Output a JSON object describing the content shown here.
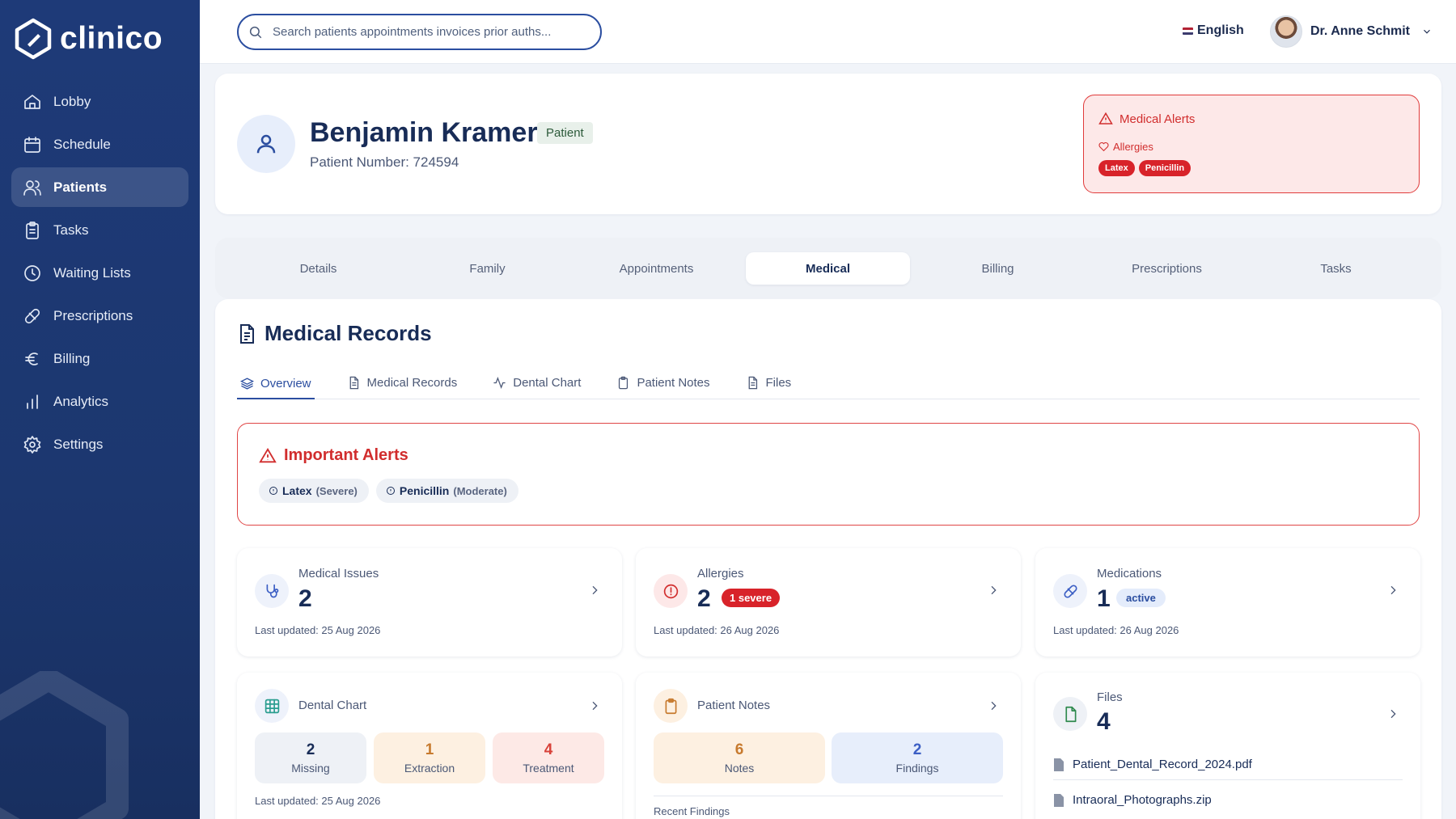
{
  "app": {
    "brand": "clinico"
  },
  "sidebar": {
    "items": [
      {
        "label": "Lobby",
        "icon": "home-icon"
      },
      {
        "label": "Schedule",
        "icon": "calendar-icon"
      },
      {
        "label": "Patients",
        "icon": "users-icon",
        "active": true
      },
      {
        "label": "Tasks",
        "icon": "clipboard-icon"
      },
      {
        "label": "Waiting Lists",
        "icon": "clock-icon"
      },
      {
        "label": "Prescriptions",
        "icon": "pill-icon"
      },
      {
        "label": "Billing",
        "icon": "euro-icon"
      },
      {
        "label": "Analytics",
        "icon": "bar-chart-icon"
      },
      {
        "label": "Settings",
        "icon": "gear-icon"
      }
    ]
  },
  "topbar": {
    "search_placeholder": "Search patients appointments invoices prior auths...",
    "language": "English",
    "user_name": "Dr. Anne Schmit"
  },
  "patient": {
    "name": "Benjamin Kramer",
    "badge": "Patient",
    "number_label": "Patient Number: 724594",
    "alerts": {
      "title": "Medical Alerts",
      "allergies_label": "Allergies",
      "pills": [
        "Latex",
        "Penicillin"
      ]
    }
  },
  "tabs": [
    {
      "label": "Details"
    },
    {
      "label": "Family"
    },
    {
      "label": "Appointments"
    },
    {
      "label": "Medical",
      "active": true
    },
    {
      "label": "Billing"
    },
    {
      "label": "Prescriptions"
    },
    {
      "label": "Tasks"
    }
  ],
  "medical": {
    "title": "Medical Records",
    "subtabs": [
      {
        "label": "Overview",
        "icon": "layers-icon",
        "active": true
      },
      {
        "label": "Medical Records",
        "icon": "document-icon"
      },
      {
        "label": "Dental Chart",
        "icon": "activity-icon"
      },
      {
        "label": "Patient Notes",
        "icon": "clipboard-icon"
      },
      {
        "label": "Files",
        "icon": "file-icon"
      }
    ],
    "important": {
      "title": "Important Alerts",
      "items": [
        {
          "name": "Latex",
          "severity": "(Severe)"
        },
        {
          "name": "Penicillin",
          "severity": "(Moderate)"
        }
      ]
    },
    "cards": {
      "issues": {
        "label": "Medical Issues",
        "value": "2",
        "updated": "Last updated: 25 Aug 2026"
      },
      "allergies": {
        "label": "Allergies",
        "value": "2",
        "chip": "1 severe",
        "updated": "Last updated: 26 Aug 2026"
      },
      "medications": {
        "label": "Medications",
        "value": "1",
        "chip": "active",
        "updated": "Last updated: 26 Aug 2026"
      },
      "dental": {
        "label": "Dental Chart",
        "stats": [
          {
            "num": "2",
            "label": "Missing"
          },
          {
            "num": "1",
            "label": "Extraction"
          },
          {
            "num": "4",
            "label": "Treatment"
          }
        ],
        "updated": "Last updated: 25 Aug 2026"
      },
      "notes": {
        "label": "Patient Notes",
        "stats": [
          {
            "num": "6",
            "label": "Notes"
          },
          {
            "num": "2",
            "label": "Findings"
          }
        ],
        "recent": "Recent Findings"
      },
      "files": {
        "label": "Files",
        "value": "4",
        "items": [
          "Patient_Dental_Record_2024.pdf",
          "Intraoral_Photographs.zip"
        ]
      }
    }
  },
  "colors": {
    "sidebar": "#1e3a78",
    "accent": "#2b4ea0",
    "alert_red": "#d8232a",
    "alert_bg": "#fde8e8"
  }
}
